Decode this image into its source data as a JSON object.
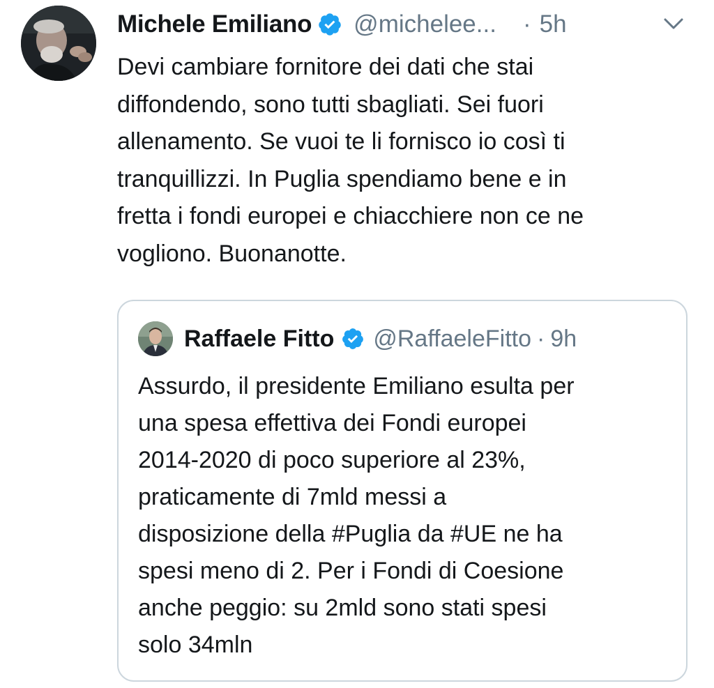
{
  "tweet": {
    "author_name": "Michele Emiliano",
    "author_handle": "@michelee...",
    "separator": "·",
    "time": "5h",
    "text": "Devi cambiare fornitore dei dati che stai\ndiffondendo, sono tutti sbagliati. Sei fuori\nallenamento. Se vuoi te li fornisco io così ti\ntranquillizzi. In Puglia spendiamo bene e in\nfretta i fondi europei e chiacchiere non ce ne\nvogliono. Buonanotte.",
    "verified_icon": "verified-badge-icon",
    "menu_icon": "chevron-down-icon"
  },
  "quoted_tweet": {
    "author_name": "Raffaele Fitto",
    "author_handle": "@RaffaeleFitto",
    "separator": "·",
    "time": "9h",
    "text": "Assurdo, il presidente Emiliano esulta per\nuna spesa effettiva dei Fondi europei\n2014-2020 di poco superiore al 23%,\npraticamente di 7mld messi a\ndisposizione della #Puglia da #UE ne ha\nspesi meno di 2. Per i Fondi di Coesione\nanche peggio: su 2mld sono stati spesi\nsolo 34mln"
  },
  "colors": {
    "text_primary": "#14171a",
    "text_secondary": "#657786",
    "verified_blue": "#1da1f2",
    "card_border": "#ccd6dd"
  }
}
